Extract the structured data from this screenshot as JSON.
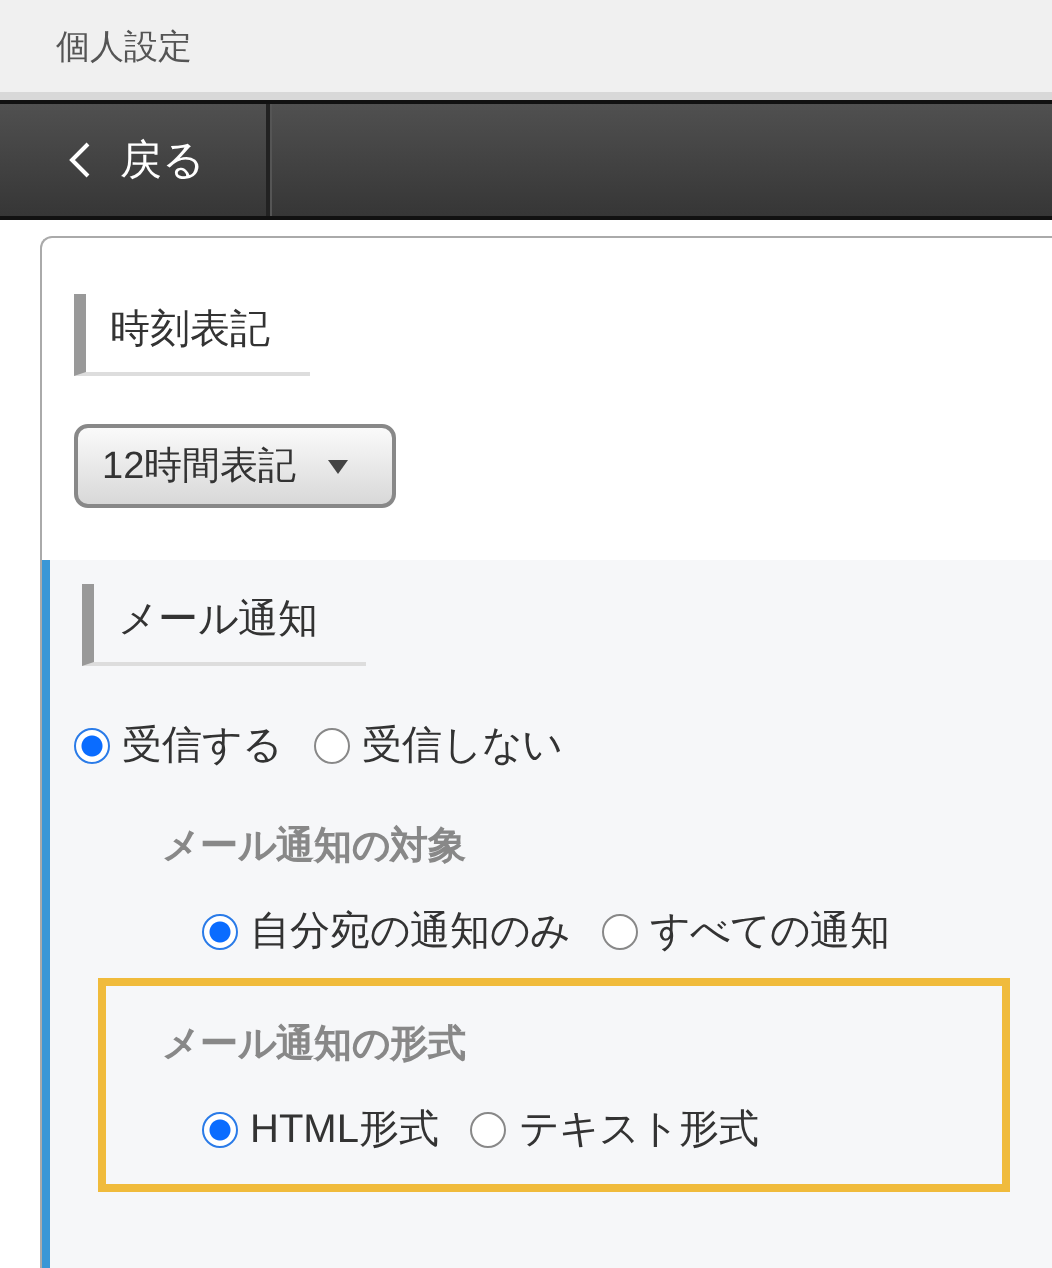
{
  "header": {
    "title": "個人設定"
  },
  "toolbar": {
    "back_button": {
      "label": "戻る"
    }
  },
  "time_format": {
    "heading": "時刻表記",
    "dropdown": {
      "value": "12時間表記"
    }
  },
  "mail_notification": {
    "heading": "メール通知",
    "options": [
      {
        "label": "受信する",
        "selected": true
      },
      {
        "label": "受信しない",
        "selected": false
      }
    ],
    "subsections": [
      {
        "heading": "メール通知の対象",
        "highlighted": false,
        "options": [
          {
            "label": "自分宛の通知のみ",
            "selected": true
          },
          {
            "label": "すべての通知",
            "selected": false
          }
        ]
      },
      {
        "heading": "メール通知の形式",
        "highlighted": true,
        "options": [
          {
            "label": "HTML形式",
            "selected": true
          },
          {
            "label": "テキスト形式",
            "selected": false
          }
        ]
      }
    ]
  }
}
